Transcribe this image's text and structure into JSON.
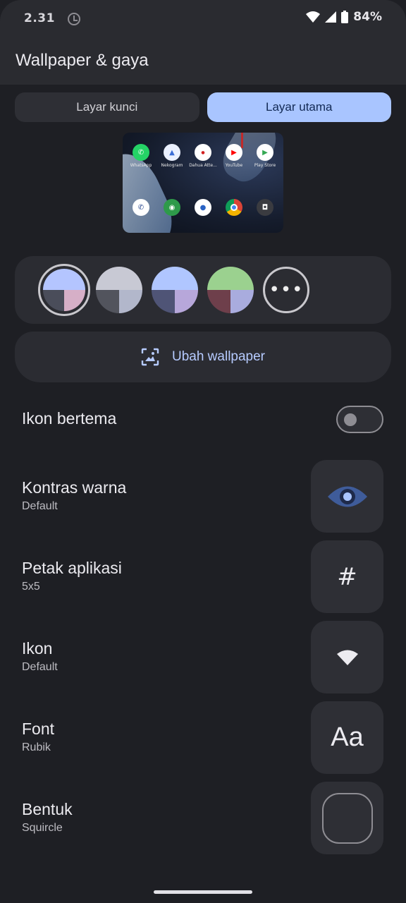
{
  "status_bar": {
    "time": "2.31",
    "battery": "84%"
  },
  "app_bar": {
    "title": "Wallpaper & gaya"
  },
  "tabs": [
    {
      "label": "Layar kunci",
      "active": false
    },
    {
      "label": "Layar utama",
      "active": true
    }
  ],
  "preview": {
    "apps_row1": [
      "WhatsApp",
      "Nekogram",
      "Dahua Atte...",
      "YouTube",
      "Play Store"
    ]
  },
  "color_options": [
    {
      "colors": [
        "#b4c5ff",
        "#b4c5ff",
        "#4a4d5a",
        "#d6afc7"
      ],
      "selected": true
    },
    {
      "colors": [
        "#c8c9d4",
        "#c8c9d4",
        "#52545d",
        "#b2b7cb"
      ],
      "selected": false
    },
    {
      "colors": [
        "#b0c6ff",
        "#b0c6ff",
        "#4f5476",
        "#b7a7da"
      ],
      "selected": false
    },
    {
      "colors": [
        "#9bd18f",
        "#9bd18f",
        "#6e3f4b",
        "#a9acde"
      ],
      "selected": false
    }
  ],
  "more_colors_label": "•••",
  "wallpaper_button": {
    "label": "Ubah wallpaper"
  },
  "settings": {
    "themed_icons": {
      "title": "Ikon bertema",
      "enabled": false
    },
    "contrast": {
      "title": "Kontras warna",
      "subtitle": "Default"
    },
    "grid": {
      "title": "Petak aplikasi",
      "subtitle": "5x5",
      "icon_text": "#"
    },
    "icons": {
      "title": "Ikon",
      "subtitle": "Default"
    },
    "font": {
      "title": "Font",
      "subtitle": "Rubik",
      "icon_text": "Aa"
    },
    "shape": {
      "title": "Bentuk",
      "subtitle": "Squircle"
    }
  },
  "accent_color": "#a9c5ff"
}
